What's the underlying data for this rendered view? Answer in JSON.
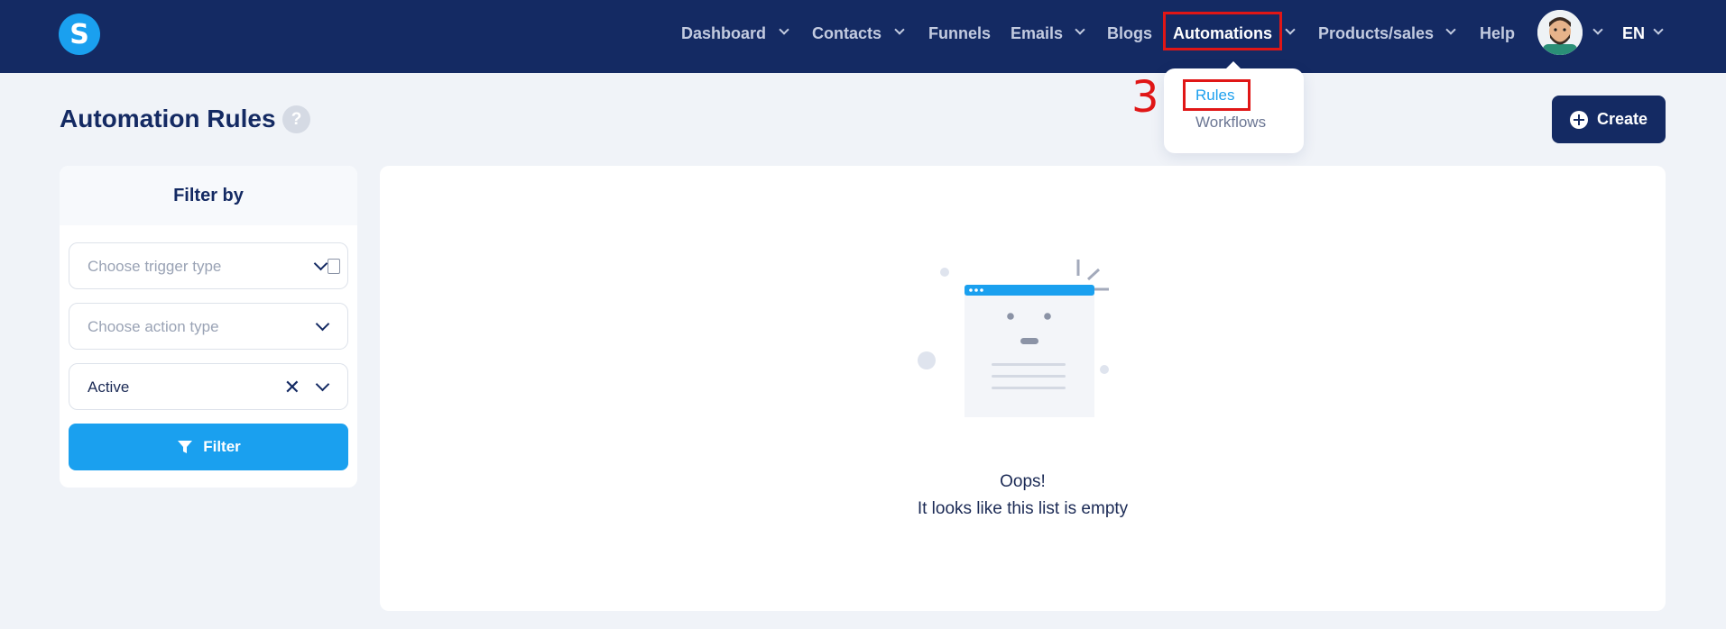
{
  "nav": {
    "logo_letter": "S",
    "items": [
      {
        "label": "Dashboard",
        "has_menu": true
      },
      {
        "label": "Contacts",
        "has_menu": true
      },
      {
        "label": "Funnels",
        "has_menu": false
      },
      {
        "label": "Emails",
        "has_menu": true
      },
      {
        "label": "Blogs",
        "has_menu": false
      },
      {
        "label": "Automations",
        "has_menu": true,
        "active": true
      },
      {
        "label": "Products/sales",
        "has_menu": true
      },
      {
        "label": "Help",
        "has_menu": false
      }
    ],
    "language": "EN"
  },
  "dropdown": {
    "items": [
      {
        "label": "Rules",
        "selected": true
      },
      {
        "label": "Workflows",
        "selected": false
      }
    ]
  },
  "annotation": {
    "step": "3"
  },
  "page": {
    "title": "Automation Rules",
    "help_label": "?",
    "create_label": "Create"
  },
  "filter": {
    "heading": "Filter by",
    "trigger_placeholder": "Choose trigger type",
    "action_placeholder": "Choose action type",
    "status_value": "Active",
    "button_label": "Filter"
  },
  "empty_state": {
    "line1": "Oops!",
    "line2": "It looks like this list is empty"
  },
  "colors": {
    "topbar": "#142a63",
    "accent": "#1aa0ef",
    "highlight": "#e01616",
    "background": "#f0f3f8"
  }
}
